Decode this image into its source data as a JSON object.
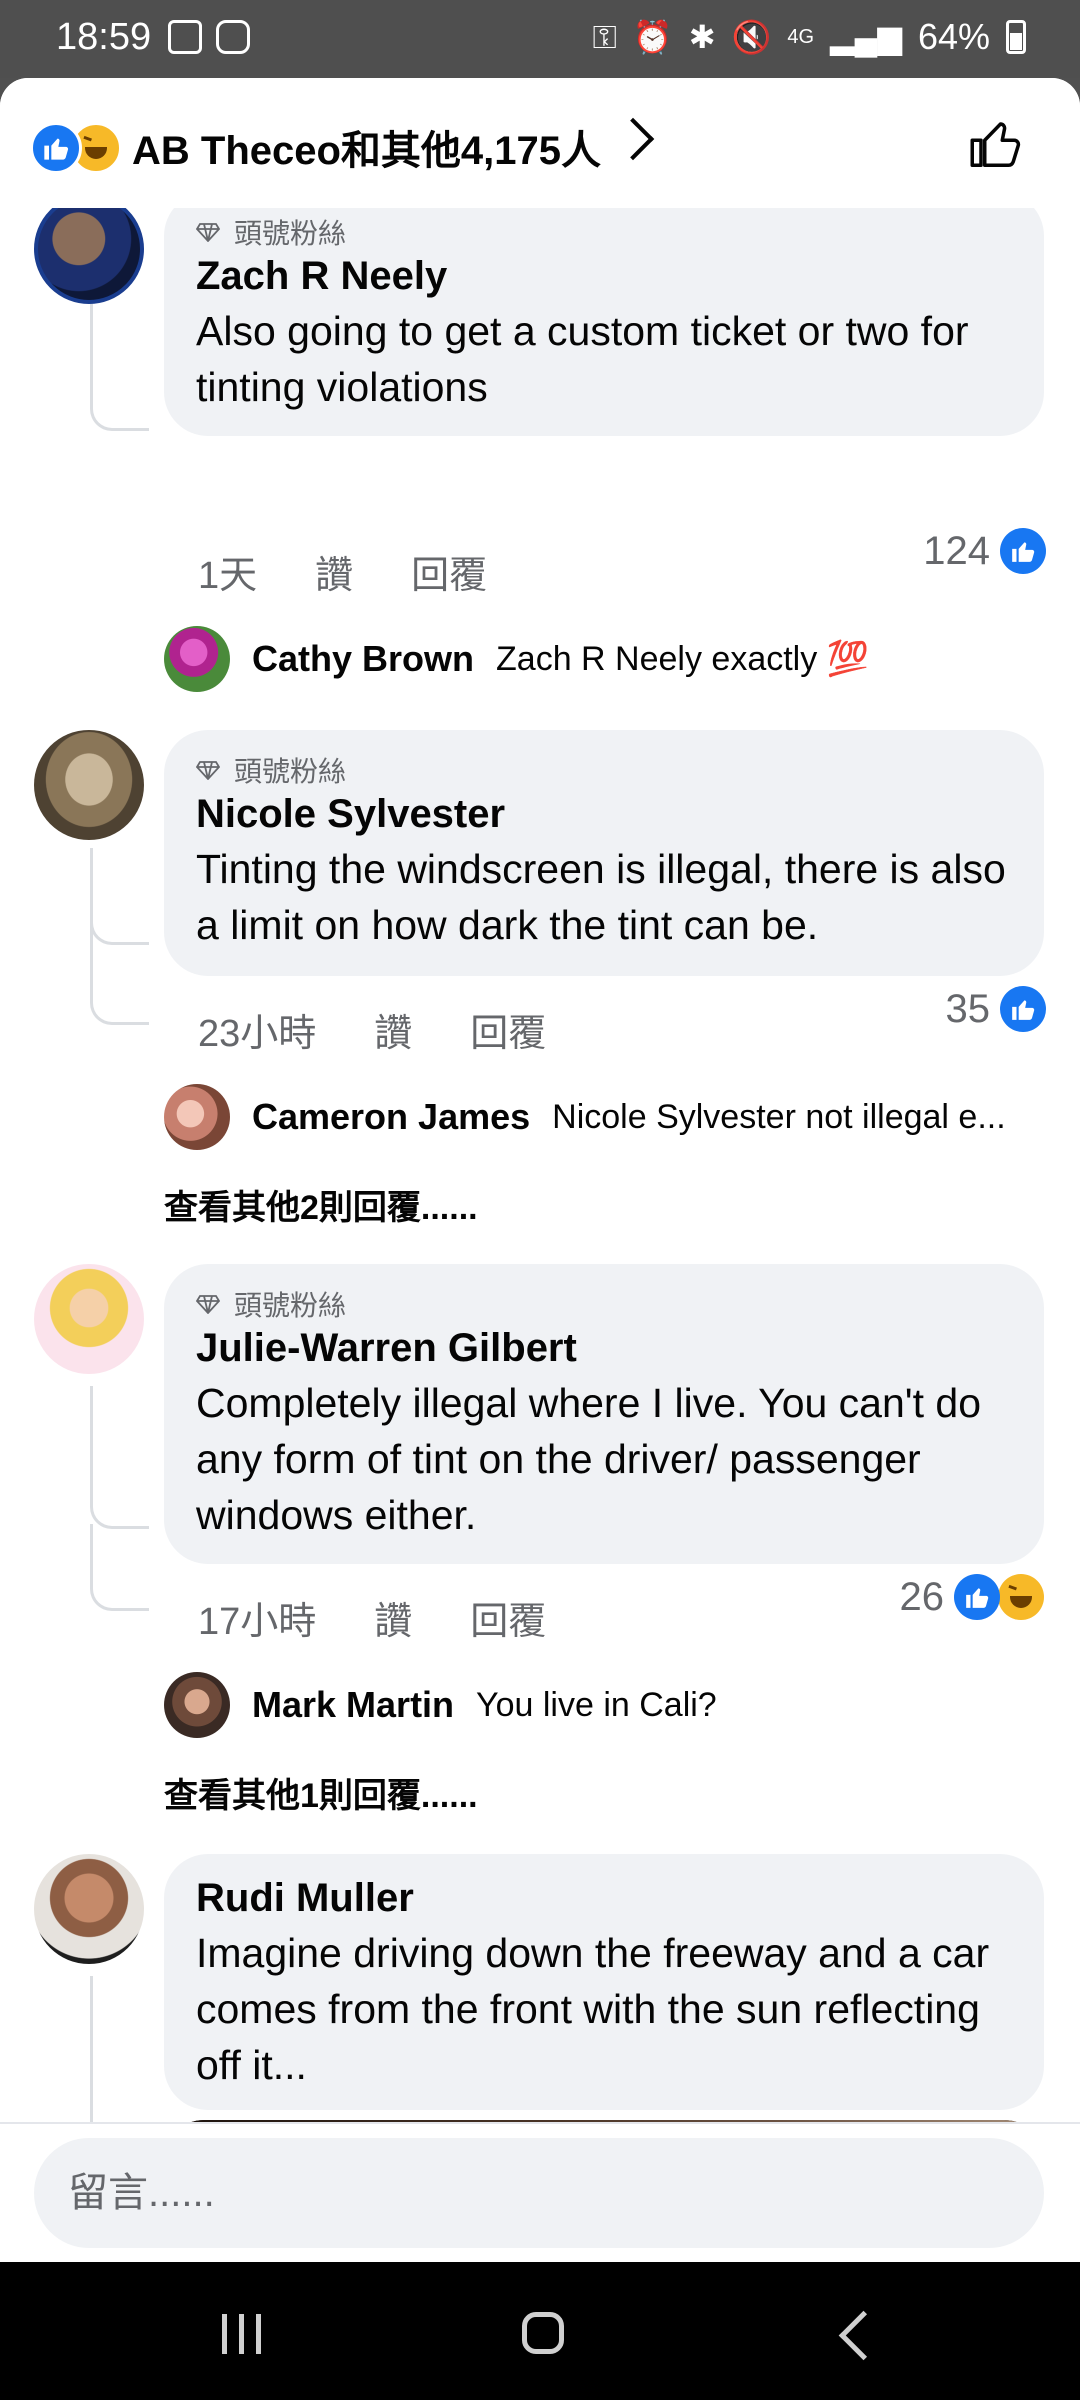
{
  "status_bar": {
    "time": "18:59",
    "battery": "64%",
    "network": "4G"
  },
  "reactions": {
    "summary": "AB Theceo和其他4,175人",
    "icons": [
      "like-icon",
      "haha-icon"
    ]
  },
  "comments": [
    {
      "badge": "頭號粉絲",
      "author": "Zach R Neely",
      "text": "Also going to get a custom ticket or two for tinting violations",
      "time": "1天",
      "like_label": "讚",
      "reply_label": "回覆",
      "reaction_count": "124",
      "replies": [
        {
          "author": "Cathy Brown",
          "text": "Zach R Neely exactly 💯"
        }
      ]
    },
    {
      "badge": "頭號粉絲",
      "author": "Nicole Sylvester",
      "text": "Tinting the windscreen is illegal, there is also a limit on how dark the tint can be.",
      "time": "23小時",
      "like_label": "讚",
      "reply_label": "回覆",
      "reaction_count": "35",
      "replies": [
        {
          "author": "Cameron James",
          "text": "Nicole Sylvester not illegal e..."
        }
      ],
      "more_replies": "查看其他2則回覆......"
    },
    {
      "badge": "頭號粉絲",
      "author": "Julie-Warren Gilbert",
      "text": "Completely illegal where I live. You can't do any form of tint on the driver/ passenger windows either.",
      "time": "17小時",
      "like_label": "讚",
      "reply_label": "回覆",
      "reaction_count": "26",
      "replies": [
        {
          "author": "Mark Martin",
          "text": "You live in Cali?"
        }
      ],
      "more_replies": "查看其他1則回覆......"
    },
    {
      "author": "Rudi Muller",
      "text": "Imagine driving down the freeway and a car comes from the front with the sun reflecting off it..."
    }
  ],
  "composer": {
    "placeholder": "留言......"
  },
  "colors": {
    "accent": "#1877f2",
    "bubble": "#f0f2f5",
    "secondary_text": "#65676b"
  }
}
